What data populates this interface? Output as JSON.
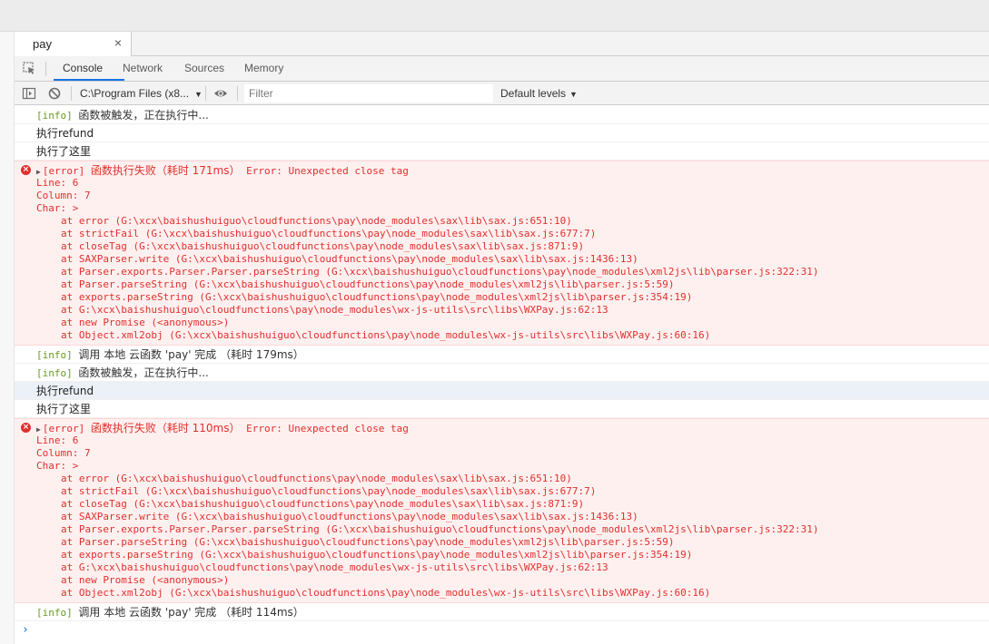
{
  "file_tab": {
    "name": "pay",
    "close": "×"
  },
  "devtools_tabs": [
    "Console",
    "Network",
    "Sources",
    "Memory"
  ],
  "toolbar": {
    "context": "C:\\Program Files (x8...",
    "filter_placeholder": "Filter",
    "levels": "Default levels"
  },
  "console": {
    "info_tag": "[info]",
    "msg_triggered": "函数被触发，正在执行中...",
    "msg_refund": "执行refund",
    "msg_here": "执行了这里",
    "error_tag": "[error]",
    "error_fail_1": "函数执行失败（耗时 171ms）",
    "error_fail_2": "函数执行失败（耗时 110ms）",
    "error_message": "Error: Unexpected close tag",
    "error_details": [
      "Line: 6",
      "Column: 7",
      "Char: >"
    ],
    "stack": [
      "at error (G:\\xcx\\baishushuiguo\\cloudfunctions\\pay\\node_modules\\sax\\lib\\sax.js:651:10)",
      "at strictFail (G:\\xcx\\baishushuiguo\\cloudfunctions\\pay\\node_modules\\sax\\lib\\sax.js:677:7)",
      "at closeTag (G:\\xcx\\baishushuiguo\\cloudfunctions\\pay\\node_modules\\sax\\lib\\sax.js:871:9)",
      "at SAXParser.write (G:\\xcx\\baishushuiguo\\cloudfunctions\\pay\\node_modules\\sax\\lib\\sax.js:1436:13)",
      "at Parser.exports.Parser.Parser.parseString (G:\\xcx\\baishushuiguo\\cloudfunctions\\pay\\node_modules\\xml2js\\lib\\parser.js:322:31)",
      "at Parser.parseString (G:\\xcx\\baishushuiguo\\cloudfunctions\\pay\\node_modules\\xml2js\\lib\\parser.js:5:59)",
      "at exports.parseString (G:\\xcx\\baishushuiguo\\cloudfunctions\\pay\\node_modules\\xml2js\\lib\\parser.js:354:19)",
      "at G:\\xcx\\baishushuiguo\\cloudfunctions\\pay\\node_modules\\wx-js-utils\\src\\libs\\WXPay.js:62:13",
      "at new Promise (<anonymous>)",
      "at Object.xml2obj (G:\\xcx\\baishushuiguo\\cloudfunctions\\pay\\node_modules\\wx-js-utils\\src\\libs\\WXPay.js:60:16)"
    ],
    "complete_1": "调用 本地 云函数 'pay' 完成  （耗时 179ms）",
    "complete_2": "调用 本地 云函数 'pay' 完成  （耗时 114ms）",
    "prompt": "›"
  }
}
